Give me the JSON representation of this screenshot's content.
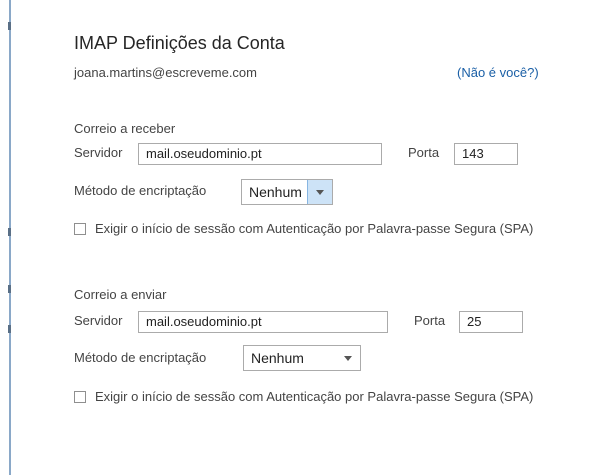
{
  "header": {
    "title": "IMAP Definições da Conta",
    "email": "joana.martins@escreveme.com",
    "not_you_link": "(Não é você?)"
  },
  "incoming": {
    "section_label": "Correio a receber",
    "server_label": "Servidor",
    "server_value": "mail.oseudominio.pt",
    "port_label": "Porta",
    "port_value": "143",
    "encryption_label": "Método de encriptação",
    "encryption_value": "Nenhum",
    "spa_label": "Exigir o início de sessão com Autenticação por Palavra-passe Segura (SPA)",
    "spa_checked": false
  },
  "outgoing": {
    "section_label": "Correio a enviar",
    "server_label": "Servidor",
    "server_value": "mail.oseudominio.pt",
    "port_label": "Porta",
    "port_value": "25",
    "encryption_label": "Método de encriptação",
    "encryption_value": "Nenhum",
    "spa_label": "Exigir o início de sessão com Autenticação por Palavra-passe Segura (SPA)",
    "spa_checked": false
  },
  "colors": {
    "link": "#1a5fa6",
    "focus_arrow_bg": "#cde3f7",
    "edge_line": "#8aa8c8"
  }
}
